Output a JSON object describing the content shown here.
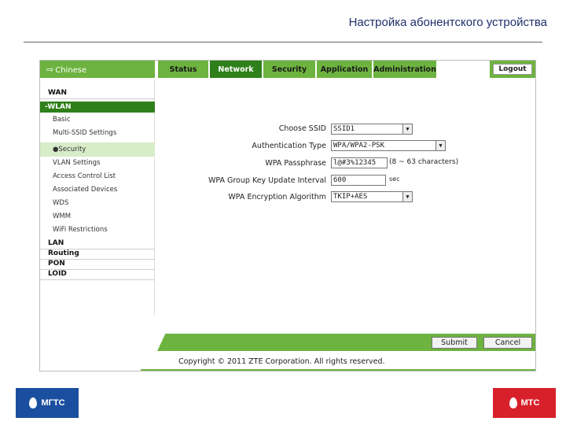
{
  "slide": {
    "title": "Настройка абонентского устройства"
  },
  "topbar": {
    "language": "Chinese",
    "tabs": [
      {
        "label": "Status"
      },
      {
        "label": "Network"
      },
      {
        "label": "Security"
      },
      {
        "label": "Application"
      },
      {
        "label": "Administration"
      }
    ],
    "active_tab": "Network",
    "logout": "Logout"
  },
  "sidebar": {
    "wan": "WAN",
    "wlan": "-WLAN",
    "wlan_items": [
      "Basic",
      "Multi-SSID Settings",
      "●Security",
      "VLAN Settings",
      "Access Control List",
      "Associated Devices",
      "WDS",
      "WMM",
      "WiFi Restrictions"
    ],
    "bottom_items": [
      "LAN",
      "Routing",
      "PON",
      "LOID"
    ]
  },
  "form": {
    "choose_ssid": {
      "label": "Choose SSID",
      "value": "SSID1"
    },
    "auth_type": {
      "label": "Authentication Type",
      "value": "WPA/WPA2-PSK"
    },
    "passphrase": {
      "label": "WPA Passphrase",
      "value": "l@#3%12345",
      "hint": "(8 ~ 63 characters)"
    },
    "group_key": {
      "label": "WPA Group Key Update Interval",
      "value": "600",
      "unit": "sec"
    },
    "encryption": {
      "label": "WPA Encryption Algorithm",
      "value": "TKIP+AES"
    }
  },
  "footer": {
    "submit": "Submit",
    "cancel": "Cancel",
    "copyright": "Copyright © 2011 ZTE Corporation. All rights reserved."
  },
  "logos": {
    "left": "МГТС",
    "right": "МТС"
  },
  "colors": {
    "green": "#6db33f",
    "dark_green": "#2f7f1a",
    "mgts_blue": "#1a4fa0",
    "mts_red": "#d8202a"
  }
}
